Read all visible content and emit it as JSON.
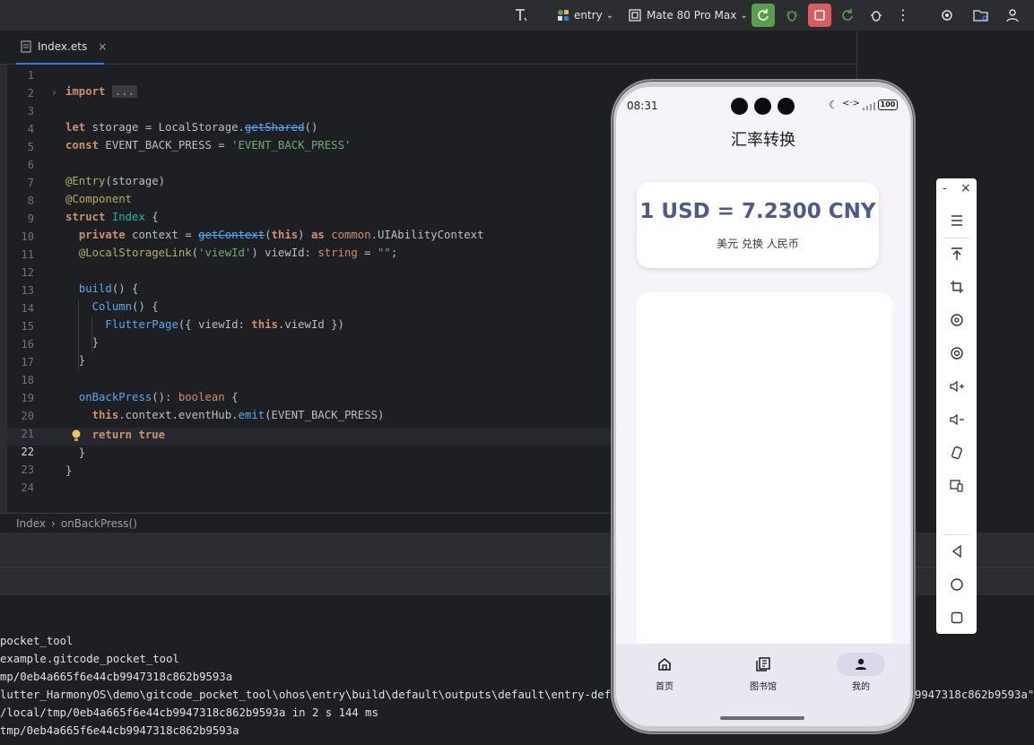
{
  "toolbar": {
    "module": "entry",
    "device": "Mate 80 Pro Max"
  },
  "editor": {
    "tab_name": "Index.ets",
    "tab_close": "×",
    "lines": [
      "1",
      "2",
      "3",
      "4",
      "5",
      "6",
      "7",
      "8",
      "9",
      "10",
      "11",
      "12",
      "13",
      "14",
      "15",
      "16",
      "17",
      "18",
      "19",
      "20",
      "21",
      "22",
      "23",
      "24"
    ],
    "fold_text": "..."
  },
  "breadcrumb": {
    "items": [
      "Index",
      "onBackPress()"
    ],
    "sep": "›"
  },
  "console": {
    "lines": [
      "pocket_tool",
      "example.gitcode_pocket_tool",
      "mp/0eb4a665f6e44cb9947318c862b9593a",
      "lutter_HarmonyOS\\demo\\gitcode_pocket_tool\\ohos\\entry\\build\\default\\outputs\\default\\entry-defa",
      "/local/tmp/0eb4a665f6e44cb9947318c862b9593a in 2 s 144 ms",
      "tmp/0eb4a665f6e44cb9947318c862b9593a"
    ],
    "overflow_tail": "9947318c862b9593a\""
  },
  "phone": {
    "time": "08:31",
    "battery": "100",
    "app_title": "汇率转换",
    "rate_text": "1 USD = 7.2300 CNY",
    "rate_sub": "美元 兑换 人民币",
    "nav": [
      {
        "label": "首页",
        "icon": "home-icon",
        "active": false
      },
      {
        "label": "图书馆",
        "icon": "library-icon",
        "active": false
      },
      {
        "label": "我的",
        "icon": "person-icon",
        "active": true
      }
    ]
  },
  "emulator_toolbar": {
    "minimize": "-",
    "close": "×"
  },
  "colors": {
    "accent_blue": "#3574f0",
    "run_green": "#5a9e4e",
    "stop_red": "#db5c5c",
    "rate_blue": "#4e5a8c",
    "nav_active": "#dcd8ea"
  }
}
